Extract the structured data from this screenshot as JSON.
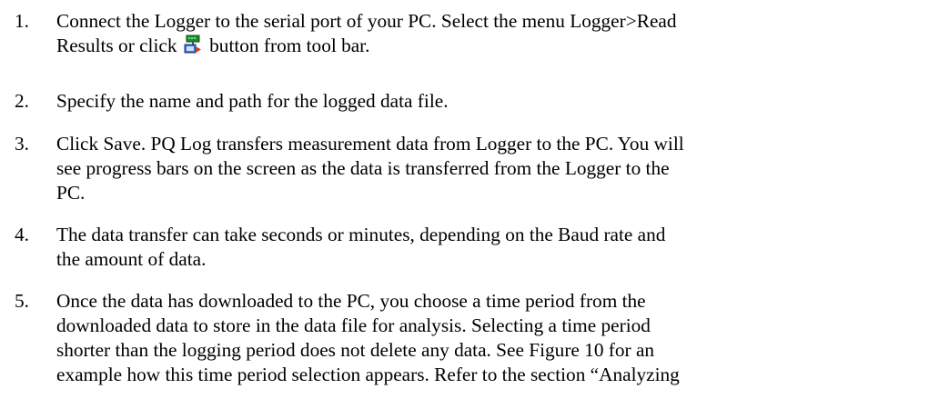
{
  "steps": [
    {
      "number": "1.",
      "lines": [
        "Connect the Logger to the serial port of your PC. Select the menu Logger>Read",
        "button from tool bar."
      ],
      "line2_prefix": "Results or click"
    },
    {
      "number": "2.",
      "lines": [
        "Specify the name and path for the logged data file."
      ]
    },
    {
      "number": "3.",
      "lines": [
        "Click Save. PQ Log transfers measurement data from Logger to the PC. You will",
        "see progress bars on the screen as the data is transferred from the Logger to the",
        "PC."
      ]
    },
    {
      "number": "4.",
      "lines": [
        "The data transfer can take seconds or minutes, depending on the Baud rate and",
        "the amount of data."
      ]
    },
    {
      "number": "5.",
      "lines": [
        "Once the data has downloaded to the PC, you choose a time period from the",
        "downloaded data to store in the data file for analysis. Selecting a time period",
        "shorter than the logging period does not delete any data. See Figure 10 for an",
        "example how this time period selection appears. Refer to the section “Analyzing"
      ]
    }
  ],
  "icons": {
    "read_results": "read-results-icon"
  }
}
